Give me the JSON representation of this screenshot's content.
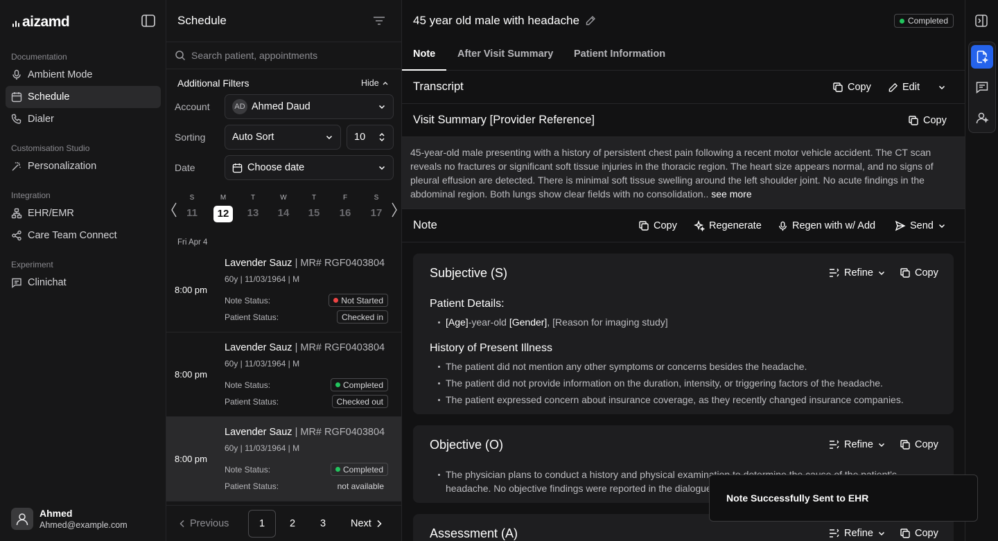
{
  "brand": {
    "logo_text": "aizamd"
  },
  "sidebar": {
    "sections": [
      {
        "label": "Documentation",
        "items": [
          {
            "label": "Ambient Mode"
          },
          {
            "label": "Schedule"
          },
          {
            "label": "Dialer"
          }
        ]
      },
      {
        "label": "Customisation Studio",
        "items": [
          {
            "label": "Personalization"
          }
        ]
      },
      {
        "label": "Integration",
        "items": [
          {
            "label": "EHR/EMR"
          },
          {
            "label": "Care Team Connect"
          }
        ]
      },
      {
        "label": "Experiment",
        "items": [
          {
            "label": "Clinichat"
          }
        ]
      }
    ],
    "active_item": "Schedule",
    "user": {
      "name": "Ahmed",
      "email": "Ahmed@example.com"
    }
  },
  "schedule": {
    "title": "Schedule",
    "search_placeholder": "Search patient, appointments",
    "filters": {
      "title": "Additional Filters",
      "hide_label": "Hide",
      "account_label": "Account",
      "account_initials": "AD",
      "account_value": "Ahmed Daud",
      "sorting_label": "Sorting",
      "sorting_value": "Auto Sort",
      "page_size": "10",
      "date_label": "Date",
      "date_value": "Choose date"
    },
    "calendar": [
      {
        "day": "S",
        "date": "11"
      },
      {
        "day": "M",
        "date": "12",
        "selected": true
      },
      {
        "day": "T",
        "date": "13"
      },
      {
        "day": "W",
        "date": "14"
      },
      {
        "day": "T",
        "date": "15"
      },
      {
        "day": "F",
        "date": "16"
      },
      {
        "day": "S",
        "date": "17"
      }
    ],
    "date_header": "Fri Apr 4",
    "appointments": [
      {
        "time": "8:00 pm",
        "name": "Lavender Sauz",
        "mr": "| MR# RGF0403804",
        "info": "60y | 11/03/1964 | M",
        "note_status_label": "Note Status:",
        "note_status": "Not Started",
        "note_color": "#ef4444",
        "patient_status_label": "Patient Status:",
        "patient_status": "Checked in"
      },
      {
        "time": "8:00 pm",
        "name": "Lavender Sauz",
        "mr": "| MR# RGF0403804",
        "info": "60y | 11/03/1964 | M",
        "note_status_label": "Note Status:",
        "note_status": "Completed",
        "note_color": "#22c55e",
        "patient_status_label": "Patient Status:",
        "patient_status": "Checked out"
      },
      {
        "time": "8:00 pm",
        "name": "Lavender Sauz",
        "mr": "| MR# RGF0403804",
        "info": "60y | 11/03/1964 | M",
        "note_status_label": "Note Status:",
        "note_status": "Completed",
        "note_color": "#22c55e",
        "patient_status_label": "Patient Status:",
        "patient_status": "not available"
      }
    ],
    "pager": {
      "previous": "Previous",
      "pages": [
        "1",
        "2",
        "3"
      ],
      "current": "1",
      "next": "Next"
    }
  },
  "main": {
    "title": "45 year old male with headache",
    "status": "Completed",
    "tabs": [
      "Note",
      "After Visit Summary",
      "Patient Information"
    ],
    "transcript": {
      "title": "Transcript",
      "copy": "Copy",
      "edit": "Edit"
    },
    "visit_summary": {
      "title": "Visit Summary [Provider Reference]",
      "copy": "Copy",
      "text": "45-year-old male presenting with a history of persistent chest pain following a recent motor vehicle accident. The CT scan reveals no fractures or significant soft tissue injuries in the thoracic region. The heart size appears normal, and no signs of pleural effusion are detected. There is minimal soft tissue swelling around the left shoulder joint. No acute findings in the abdominal region. Both lungs show clear fields with no consolidation..",
      "see_more": "see more"
    },
    "note": {
      "title": "Note",
      "copy": "Copy",
      "regenerate": "Regenerate",
      "regen_add": "Regen with w/ Add",
      "send": "Send"
    },
    "sections": {
      "subjective": {
        "title": "Subjective (S)",
        "refine": "Refine",
        "copy": "Copy",
        "patient_details_heading": "Patient Details:",
        "patient_details": {
          "age": "[Age]",
          "age_suffix": "-year-old",
          "gender": "[Gender]",
          "reason": ", [Reason for imaging study]"
        },
        "hpi_heading": "History of Present Illness",
        "hpi": [
          "The patient did not mention any other symptoms or concerns besides the headache.",
          "The patient did not provide information on the duration, intensity, or triggering factors of the headache.",
          "The patient expressed concern about insurance coverage, as they recently changed insurance companies."
        ]
      },
      "objective": {
        "title": "Objective (O)",
        "refine": "Refine",
        "copy": "Copy",
        "line1": "The physician plans to conduct a history and physical examination to determine the cause of the patient's",
        "line2": "headache. No objective findings were reported in the dialogue."
      },
      "assessment": {
        "title": "Assessment (A)",
        "refine": "Refine",
        "copy": "Copy"
      }
    }
  },
  "toast": {
    "message": "Note Successfully Sent to EHR"
  },
  "colors": {
    "accent": "#2563eb",
    "success": "#22c55e",
    "danger": "#ef4444"
  }
}
